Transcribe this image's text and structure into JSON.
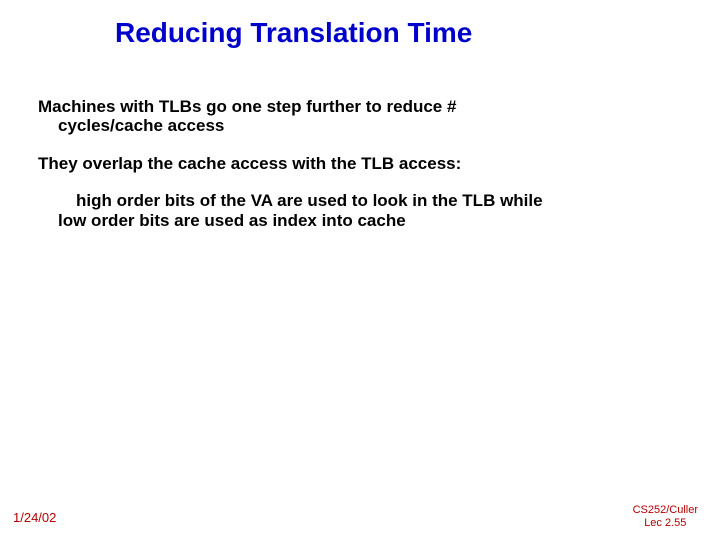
{
  "title": "Reducing Translation Time",
  "body": {
    "p1_l1": "Machines with TLBs go one step further to reduce #",
    "p1_l2": "cycles/cache access",
    "p2": "They overlap the cache access with the TLB access:",
    "p3_l1": "high order bits of the VA are used to look in the TLB while",
    "p3_l2": "low order bits are used as index into cache"
  },
  "footer": {
    "date": "1/24/02",
    "course": "CS252/Culler",
    "lecture": "Lec 2.55"
  }
}
